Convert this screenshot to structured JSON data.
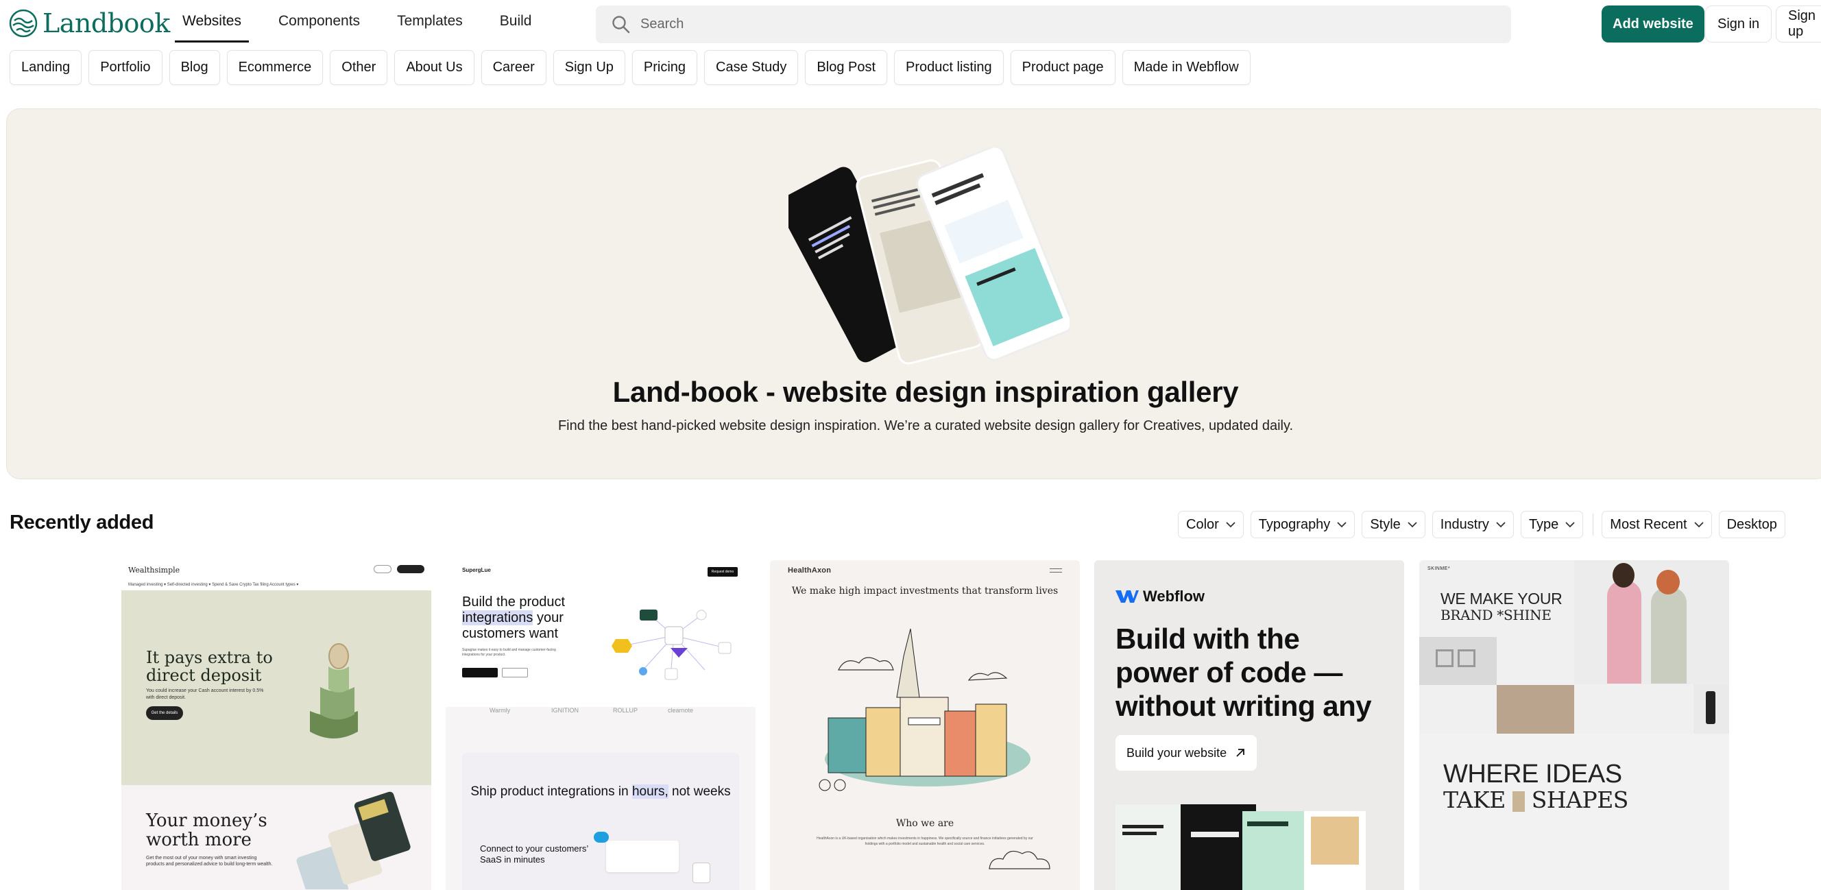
{
  "brand": {
    "name": "Landbook",
    "color": "#0b6d5d"
  },
  "nav": {
    "links": [
      "Websites",
      "Components",
      "Templates",
      "Build"
    ],
    "active": "Websites"
  },
  "search": {
    "placeholder": "Search"
  },
  "actions": {
    "add_website": "Add website",
    "sign_in": "Sign in",
    "sign_up": "Sign up"
  },
  "categories": [
    "Landing",
    "Portfolio",
    "Blog",
    "Ecommerce",
    "Other",
    "About Us",
    "Career",
    "Sign Up",
    "Pricing",
    "Case Study",
    "Blog Post",
    "Product listing",
    "Product page",
    "Made in Webflow"
  ],
  "hero": {
    "title": "Land-book - website design inspiration gallery",
    "subtitle": "Find the best hand-picked website design inspiration. We’re a curated website design gallery for Creatives, updated daily."
  },
  "recent": {
    "title": "Recently added",
    "filters": [
      "Color",
      "Typography",
      "Style",
      "Industry",
      "Type"
    ],
    "sort": "Most Recent",
    "device": "Desktop"
  },
  "cards": {
    "c1": {
      "logo": "Wealthsimple",
      "nav": "Managed investing ▾   Self-directed investing ▾   Spend & Save   Crypto   Tax filing   Account types ▾",
      "headline": "It pays extra to direct deposit",
      "body": "You could increase your Cash account interest by 0.5% with direct deposit.",
      "cta": "Get the details",
      "headline2": "Your money’s worth more",
      "body2": "Get the most out of your money with smart investing products and personalized advice to build long-term wealth."
    },
    "c2": {
      "logo": "SupergLue",
      "nav_button": "Request demo",
      "headline_a": "Build the product ",
      "headline_hl": "integrations",
      "headline_b": " your customers want",
      "body": "Supaglue makes it easy to build and manage customer-facing integrations for your product.",
      "logos": [
        "Warmly",
        "IGNITION",
        "ROLLUP",
        "clearnote"
      ],
      "headline2_a": "Ship product integrations in ",
      "headline2_hl": "hours,",
      "headline2_b": " not weeks",
      "sub": "Connect to your customers’ SaaS in minutes"
    },
    "c3": {
      "logo": "HealthAxon",
      "headline": "We make high impact investments that transform lives",
      "who": "Who we are",
      "body": "HealthAxon is a UK-based organisation which makes investments in happiness. We specifically source and finance initiatives generated by our holdings with a portfolio model and sustainable health and social care services."
    },
    "c4": {
      "logo": "Webflow",
      "headline": "Build with the power of code — without writing any",
      "cta": "Build your website"
    },
    "c5": {
      "logo": "SKINME*",
      "headline_a": "WE MAKE YOUR",
      "headline_b": "BRAND *SHINE",
      "headline2_a": "WHERE IDEAS",
      "headline2_b": "TAKE",
      "headline2_c": "SHAPES"
    }
  }
}
